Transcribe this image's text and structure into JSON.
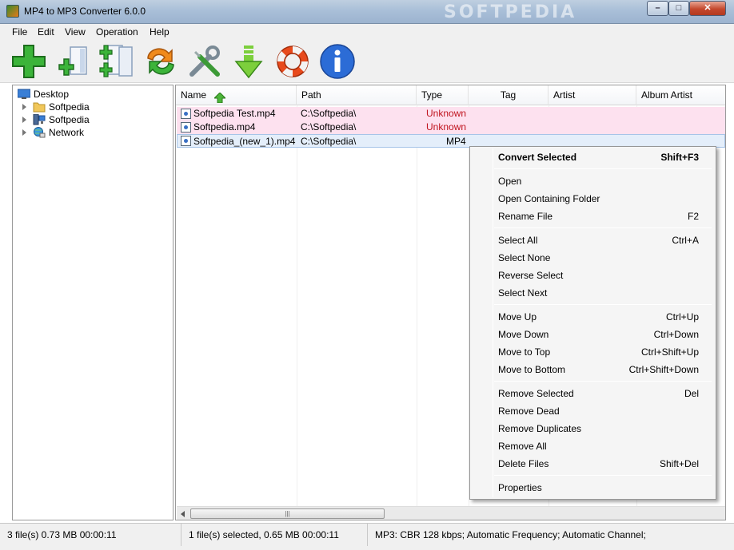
{
  "window": {
    "title": "MP4 to MP3 Converter 6.0.0",
    "watermark": "SOFTPEDIA",
    "controls": {
      "minimize": "–",
      "maximize": "□",
      "close": "✕"
    }
  },
  "menubar": [
    "File",
    "Edit",
    "View",
    "Operation",
    "Help"
  ],
  "toolbar": [
    {
      "name": "add-files-icon"
    },
    {
      "name": "add-single-file-icon"
    },
    {
      "name": "add-folder-icon"
    },
    {
      "name": "convert-icon"
    },
    {
      "name": "settings-tools-icon"
    },
    {
      "name": "download-icon"
    },
    {
      "name": "help-lifebuoy-icon"
    },
    {
      "name": "about-info-icon"
    }
  ],
  "tree": {
    "root": "Desktop",
    "children": [
      "Softpedia",
      "Softpedia",
      "Network"
    ]
  },
  "file_list": {
    "columns": [
      "Name",
      "Path",
      "Type",
      "Tag",
      "Artist",
      "Album Artist"
    ],
    "rows": [
      {
        "name": "Softpedia Test.mp4",
        "path": "C:\\Softpedia\\",
        "type": "Unknown",
        "state": "dead"
      },
      {
        "name": "Softpedia.mp4",
        "path": "C:\\Softpedia\\",
        "type": "Unknown",
        "state": "dead"
      },
      {
        "name": "Softpedia_(new_1).mp4",
        "path": "C:\\Softpedia\\",
        "type": "MP4",
        "state": "selected"
      }
    ],
    "scroll_grip": "|||"
  },
  "context_menu": {
    "items": [
      {
        "label": "Convert Selected",
        "shortcut": "Shift+F3",
        "bold": true
      },
      {
        "sep": true
      },
      {
        "label": "Open",
        "shortcut": ""
      },
      {
        "label": "Open Containing Folder",
        "shortcut": ""
      },
      {
        "label": "Rename File",
        "shortcut": "F2"
      },
      {
        "sep": true
      },
      {
        "label": "Select All",
        "shortcut": "Ctrl+A"
      },
      {
        "label": "Select None",
        "shortcut": ""
      },
      {
        "label": "Reverse Select",
        "shortcut": ""
      },
      {
        "label": "Select Next",
        "shortcut": ""
      },
      {
        "sep": true
      },
      {
        "label": "Move Up",
        "shortcut": "Ctrl+Up"
      },
      {
        "label": "Move Down",
        "shortcut": "Ctrl+Down"
      },
      {
        "label": "Move to Top",
        "shortcut": "Ctrl+Shift+Up"
      },
      {
        "label": "Move to Bottom",
        "shortcut": "Ctrl+Shift+Down"
      },
      {
        "sep": true
      },
      {
        "label": "Remove Selected",
        "shortcut": "Del"
      },
      {
        "label": "Remove Dead",
        "shortcut": ""
      },
      {
        "label": "Remove Duplicates",
        "shortcut": ""
      },
      {
        "label": "Remove All",
        "shortcut": ""
      },
      {
        "label": "Delete Files",
        "shortcut": "Shift+Del"
      },
      {
        "sep": true
      },
      {
        "label": "Properties",
        "shortcut": ""
      }
    ]
  },
  "statusbar": {
    "total": "3 file(s)   0.73 MB   00:00:11",
    "selected": "1 file(s) selected, 0.65 MB   00:00:11",
    "format": "MP3:  CBR 128 kbps; Automatic Frequency; Automatic Channel;"
  },
  "colors": {
    "dead_row": "#fde1ef",
    "unknown_text": "#c0141e",
    "selected_row": "#e4eefa"
  }
}
